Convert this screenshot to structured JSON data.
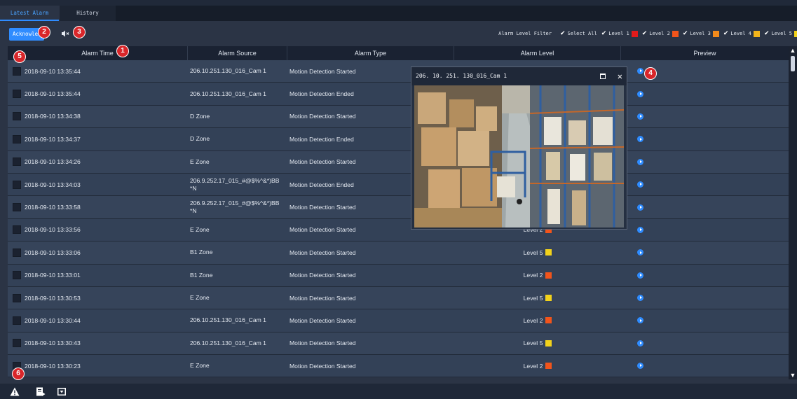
{
  "tabs": [
    "Latest Alarm",
    "History"
  ],
  "toolbar": {
    "acknowledge_label": "Acknowledge",
    "filter_label": "Alarm Level Filter",
    "filter_options": [
      {
        "label": "Select All",
        "color": null
      },
      {
        "label": "Level 1",
        "color": "#e21b1b"
      },
      {
        "label": "Level 2",
        "color": "#f2541b"
      },
      {
        "label": "Level 3",
        "color": "#f28a1b"
      },
      {
        "label": "Level 4",
        "color": "#f2b41b"
      },
      {
        "label": "Level 5",
        "color": "#f2d21b"
      }
    ]
  },
  "table": {
    "columns": [
      "Alarm Time",
      "Alarm Source",
      "Alarm Type",
      "Alarm Level",
      "Preview"
    ],
    "rows": [
      {
        "time": "2018-09-10 13:35:44",
        "source": "206.10.251.130_016_Cam 1",
        "type": "Motion Detection Started",
        "level": ""
      },
      {
        "time": "2018-09-10 13:35:44",
        "source": "206.10.251.130_016_Cam 1",
        "type": "Motion Detection Ended",
        "level": ""
      },
      {
        "time": "2018-09-10 13:34:38",
        "source": "D Zone",
        "type": "Motion Detection Started",
        "level": ""
      },
      {
        "time": "2018-09-10 13:34:37",
        "source": "D Zone",
        "type": "Motion Detection Ended",
        "level": ""
      },
      {
        "time": "2018-09-10 13:34:26",
        "source": "E Zone",
        "type": "Motion Detection Started",
        "level": ""
      },
      {
        "time": "2018-09-10 13:34:03",
        "source": "206.9.252.17_015_#@$%^&*)BB *N",
        "type": "Motion Detection Ended",
        "level": ""
      },
      {
        "time": "2018-09-10 13:33:58",
        "source": "206.9.252.17_015_#@$%^&*)BB *N",
        "type": "Motion Detection Started",
        "level": ""
      },
      {
        "time": "2018-09-10 13:33:56",
        "source": "E Zone",
        "type": "Motion Detection Started",
        "level": "Level 2",
        "level_color": "#f2541b"
      },
      {
        "time": "2018-09-10 13:33:06",
        "source": "B1 Zone",
        "type": "Motion Detection Started",
        "level": "Level 5",
        "level_color": "#f2d21b"
      },
      {
        "time": "2018-09-10 13:33:01",
        "source": "B1 Zone",
        "type": "Motion Detection Started",
        "level": "Level 2",
        "level_color": "#f2541b"
      },
      {
        "time": "2018-09-10 13:30:53",
        "source": "E Zone",
        "type": "Motion Detection Started",
        "level": "Level 5",
        "level_color": "#f2d21b"
      },
      {
        "time": "2018-09-10 13:30:44",
        "source": "206.10.251.130_016_Cam 1",
        "type": "Motion Detection Started",
        "level": "Level 2",
        "level_color": "#f2541b"
      },
      {
        "time": "2018-09-10 13:30:43",
        "source": "206.10.251.130_016_Cam 1",
        "type": "Motion Detection Started",
        "level": "Level 5",
        "level_color": "#f2d21b"
      },
      {
        "time": "2018-09-10 13:30:23",
        "source": "E Zone",
        "type": "Motion Detection Started",
        "level": "Level 2",
        "level_color": "#f2541b"
      }
    ]
  },
  "preview_window": {
    "title": "206. 10. 251. 130_016_Cam 1",
    "content": "warehouse-camera-feed"
  },
  "callouts": [
    "1",
    "2",
    "3",
    "4",
    "5",
    "6"
  ],
  "icons": {
    "sound": "speaker-mute-icon",
    "bottom": [
      "alarm-warning-icon",
      "export-file-icon",
      "download-clip-icon"
    ],
    "preview_play": "play-icon"
  },
  "colors": {
    "accent": "#2f8cff",
    "callout": "#d9262a"
  }
}
